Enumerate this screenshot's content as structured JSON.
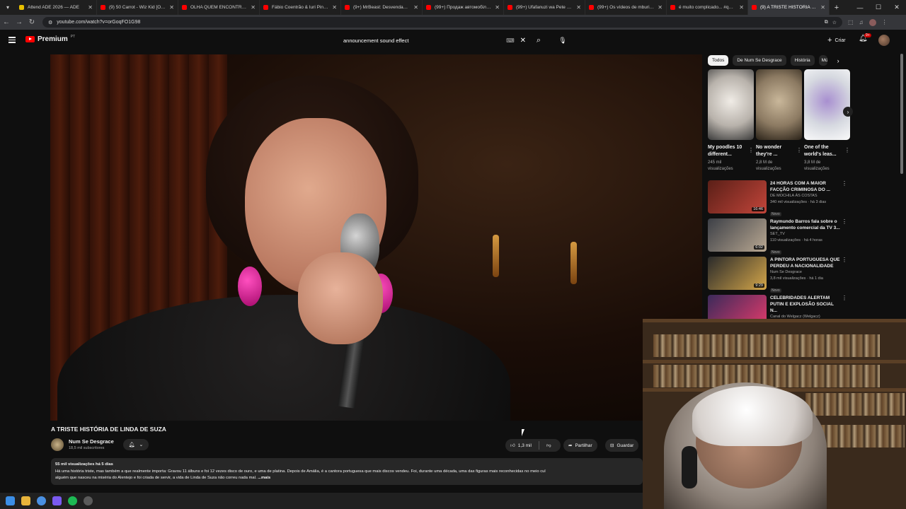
{
  "browser": {
    "tabs": [
      {
        "title": "Attend ADE 2026 — ADE",
        "color": "#e7c000"
      },
      {
        "title": "(9) 50 Carrot - Wiz Kid [OFFICI",
        "color": "#ff0000"
      },
      {
        "title": "OLHA QUEM ENCONTREI PO",
        "color": "#ff0000"
      },
      {
        "title": "Fábio Coentrão & Iuri Pinto n",
        "color": "#ff0000"
      },
      {
        "title": "(9+) MrBeast: Desvendando o",
        "color": "#ff0000"
      },
      {
        "title": "(99+) Продаж автомобілю @",
        "color": "#ff0000"
      },
      {
        "title": "(99+) Ufafanuzi wa Pete za Bal",
        "color": "#ff0000"
      },
      {
        "title": "(99+) Os vídeos de mburi ofic",
        "color": "#ff0000"
      },
      {
        "title": "é muito complicado... #queir",
        "color": "#ff0000"
      },
      {
        "title": "(9) A TRISTE HISTÓRIA DE",
        "color": "#ff0000",
        "active": true
      }
    ],
    "url": "youtube.com/watch?v=orGoqFO1G98"
  },
  "yt": {
    "logo_text": "Premium",
    "country": "PT",
    "search_value": "announcement sound effect",
    "create_label": "Criar",
    "notif_count": "9+"
  },
  "video": {
    "title": "A TRISTE HISTÓRIA DE LINDA DE SUZA",
    "channel": "Num Se Desgrace",
    "subscribers": "18,5 mil subscritores",
    "likes": "1,3 mil",
    "share_label": "Partilhar",
    "save_label": "Guardar",
    "views_date": "55 mil visualizações  há 5 dias",
    "description": "Há uma história triste, mas também a que realmente importa: Gravou 11 álbuns e foi 12 vezes disco de ouro, e uma de platina. Depois de Amália, é a cantora portuguesa que mais discos vendeu. Foi, durante uma década, uma das figuras mais reconhecidas no meio cul",
    "description2": "alguém que nasceu na miséria do Alentejo e foi criada de servir, a vida de Linda de Suza não correu nada mal.",
    "more_label": "...mais"
  },
  "sidebar": {
    "chips": [
      "Todos",
      "De Num Se Desgrace",
      "História",
      "Mú"
    ],
    "shorts": [
      {
        "title": "My poodles 10 different...",
        "views": "245 mil visualizações",
        "colors": [
          "#b8b2ab",
          "#f0ece6",
          "#3a3a3a"
        ]
      },
      {
        "title": "No wonder they're ...",
        "views": "2,8 M de visualizações",
        "colors": [
          "#8c7a62",
          "#c9b79a",
          "#2a2218"
        ]
      },
      {
        "title": "One of the world's leas...",
        "views": "3,8 M de visualizações",
        "colors": [
          "#d6d9e0",
          "#a88fd0",
          "#fafafa"
        ]
      }
    ],
    "recs": [
      {
        "title": "24 HORAS COM A MAIOR FACÇÃO CRIMINOSA DO ...",
        "channel": "DE MOCHILA ÀS COSTAS",
        "views": "340 mil visualizações · há 3 dias",
        "badge": "Novo",
        "duration": "16:46",
        "colors": [
          "#5a1f17",
          "#c2453a"
        ]
      },
      {
        "title": "Raymundo Barros fala sobre o lançamento comercial da TV 3...",
        "channel": "SET_TV",
        "views": "110 visualizações · há 4 horas",
        "badge": "Novo",
        "duration": "6:02",
        "colors": [
          "#3c3f46",
          "#b9a892"
        ]
      },
      {
        "title": "A PINTORA PORTUGUESA QUE PERDEU A NACIONALIDADE",
        "channel": "Num Se Desgrace",
        "views": "3,8 mil visualizações · há 1 dia",
        "badge": "Novo",
        "duration": "9:29",
        "colors": [
          "#2a2a2a",
          "#d4a64a"
        ]
      },
      {
        "title": "CELEBRIDADES ALERTAM PUTIN E EXPLOSÃO SOCIAL N...",
        "channel": "Canal do Welgacz (Welgacz)",
        "views": "",
        "badge": "",
        "duration": "",
        "colors": [
          "#3b2a5a",
          "#e23b6b"
        ]
      }
    ]
  }
}
